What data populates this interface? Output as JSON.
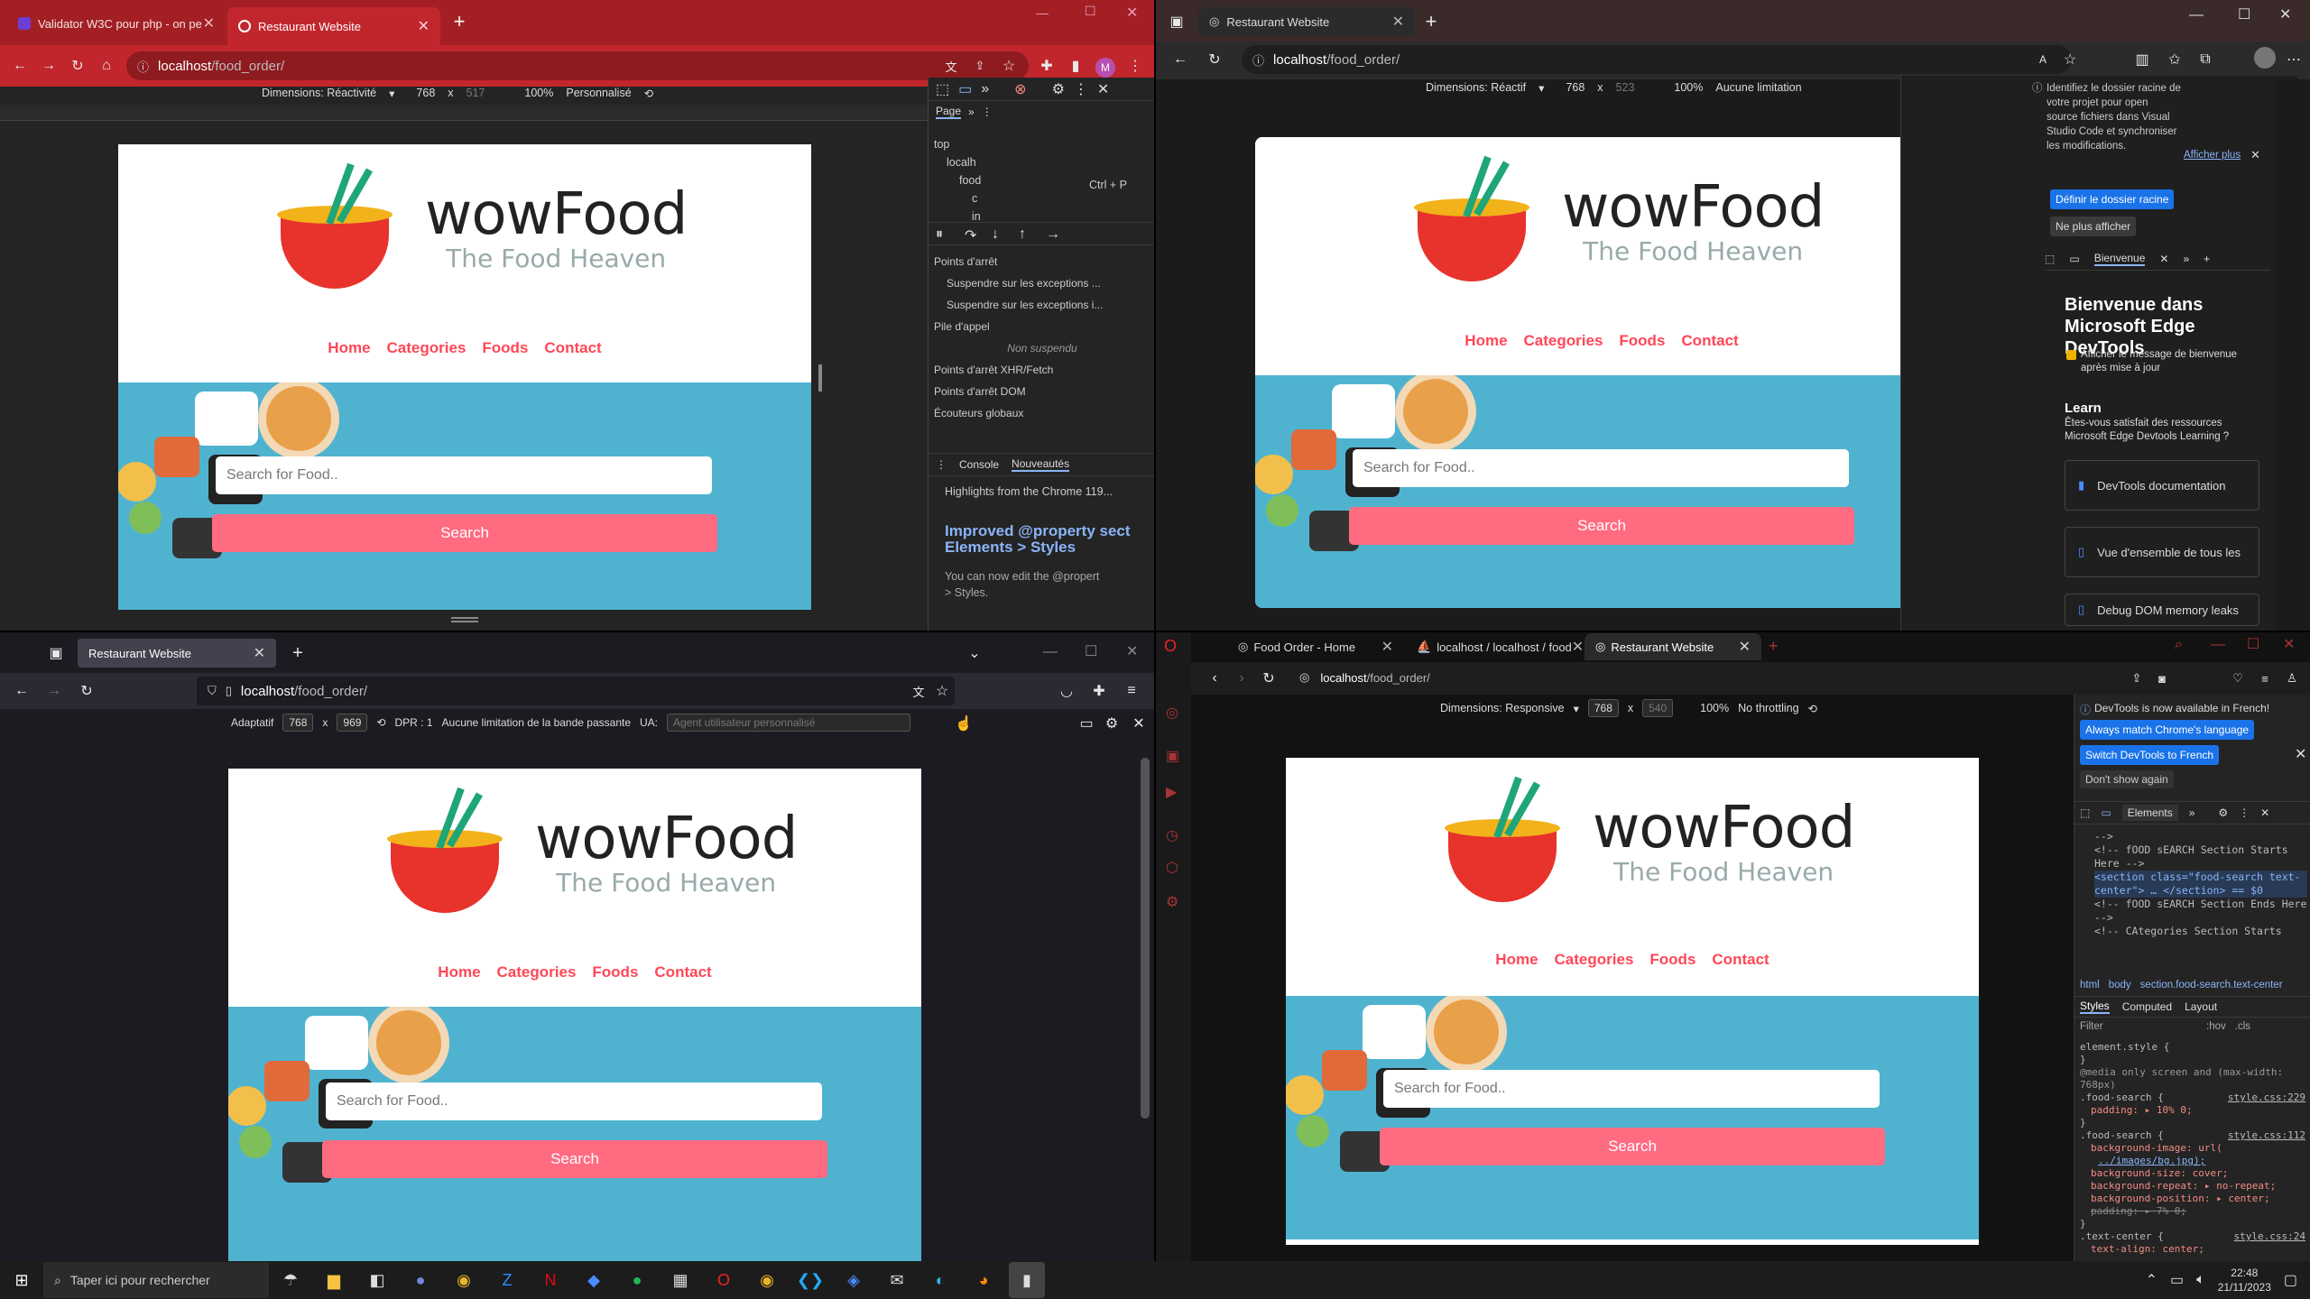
{
  "site": {
    "brand": "wowFood",
    "tagline": "The Food Heaven",
    "nav": [
      "Home",
      "Categories",
      "Foods",
      "Contact"
    ],
    "search_placeholder": "Search for Food..",
    "search_button": "Search",
    "colors": {
      "accent": "#ff4757",
      "button": "#ff6b81",
      "hero": "#4fb3d0"
    }
  },
  "chrome": {
    "tabs": [
      "Validator W3C pour php - on pe",
      "Restaurant Website"
    ],
    "new_tab": "+",
    "url_host": "localhost",
    "url_path": "/food_order/",
    "device": {
      "dimensions": "Dimensions: Réactivité",
      "width": "768",
      "x": "x",
      "height": "517",
      "zoom": "100%",
      "throttle": "Personnalisé"
    },
    "avatar": "M",
    "devtools": {
      "page_tab": "Page",
      "tree": [
        "top",
        "localh",
        "food",
        "c",
        "in"
      ],
      "shortcut": "Ctrl + P",
      "breakpoints": "Points d'arrêt",
      "bp_items": [
        "Suspendre sur les exceptions ...",
        "Suspendre sur les exceptions i..."
      ],
      "callstack": "Pile d'appel",
      "not_paused": "Non suspendu",
      "sections": [
        "Points d'arrêt XHR/Fetch",
        "Points d'arrêt DOM",
        "Écouteurs globaux"
      ],
      "drawer_tabs": [
        "Console",
        "Nouveautés"
      ],
      "highlight": "Highlights from the Chrome 119...",
      "improved": "Improved @property sect",
      "elements_styles": "Elements > Styles",
      "edit_text": "You can now edit the @propert",
      "styles_text": "> Styles."
    }
  },
  "edge": {
    "tab": "Restaurant Website",
    "url_host": "localhost",
    "url_path": "/food_order/",
    "device": {
      "dimensions": "Dimensions: Réactif",
      "width": "768",
      "x": "x",
      "height": "523",
      "zoom": "100%",
      "throttle": "Aucune limitation"
    },
    "devtools": {
      "notice": "Identifiez le dossier racine de votre projet pour open source fichiers dans Visual Studio Code et synchroniser les modifications.",
      "show_more": "Afficher plus",
      "define_root": "Définir le dossier racine",
      "never_show": "Ne plus afficher",
      "welcome_tab": "Bienvenue",
      "welcome_title": "Bienvenue dans Microsoft Edge DevTools",
      "welcome_check": "Afficher le message de bienvenue après mise à jour",
      "learn": "Learn",
      "learn_text": "Êtes-vous satisfait des ressources Microsoft Edge Devtools Learning ?",
      "cards": [
        "DevTools documentation",
        "Vue d'ensemble de tous les",
        "Debug DOM memory leaks"
      ]
    }
  },
  "firefox": {
    "tab": "Restaurant Website",
    "url_host": "localhost",
    "url_path": "/food_order/",
    "device": {
      "mode": "Adaptatif",
      "width": "768",
      "x": "x",
      "height": "969",
      "dpr": "DPR : 1",
      "throttle": "Aucune limitation de la bande passante",
      "ua": "UA:",
      "ua_placeholder": "Agent utilisateur personnalisé"
    }
  },
  "opera": {
    "tabs": [
      "Food Order - Home",
      "localhost / localhost / food",
      "Restaurant Website"
    ],
    "url_host": "localhost",
    "url_path": "/food_order/",
    "device": {
      "dimensions": "Dimensions: Responsive",
      "width": "768",
      "x": "x",
      "height": "540",
      "zoom": "100%",
      "throttle": "No throttling"
    },
    "devtools": {
      "notice": "DevTools is now available in French!",
      "btn1": "Always match Chrome's language",
      "btn2": "Switch DevTools to French",
      "dont_show": "Don't show again",
      "panel": "Elements",
      "code": [
        "-->",
        "<!-- fOOD sEARCH Section Starts Here -->",
        "<section class=\"food-search text-center\"> … </section> == $0",
        "<!-- fOOD sEARCH Section Ends Here -->",
        "<!-- CAtegories Section Starts"
      ],
      "breadcrumbs": [
        "html",
        "body",
        "section.food-search.text-center"
      ],
      "style_tabs": [
        "Styles",
        "Computed",
        "Layout"
      ],
      "filter": "Filter",
      "hov": ":hov",
      "cls": ".cls",
      "css": [
        "element.style {",
        "}",
        "@media only screen and (max-width: 768px)",
        ".food-search {",
        "padding: ▸ 10% 0;",
        "}",
        ".food-search {",
        "background-image: url(",
        "../images/bg.jpg);",
        "background-size: cover;",
        "background-repeat: ▸ no-repeat;",
        "background-position: ▸ center;",
        "padding: ▸ 7% 0;",
        "}",
        ".text-center {",
        "text-align: center;"
      ],
      "links": [
        "style.css:229",
        "style.css:112",
        "style.css:24"
      ]
    }
  },
  "taskbar": {
    "search_placeholder": "Taper ici pour rechercher",
    "time": "22:48",
    "date": "21/11/2023"
  }
}
